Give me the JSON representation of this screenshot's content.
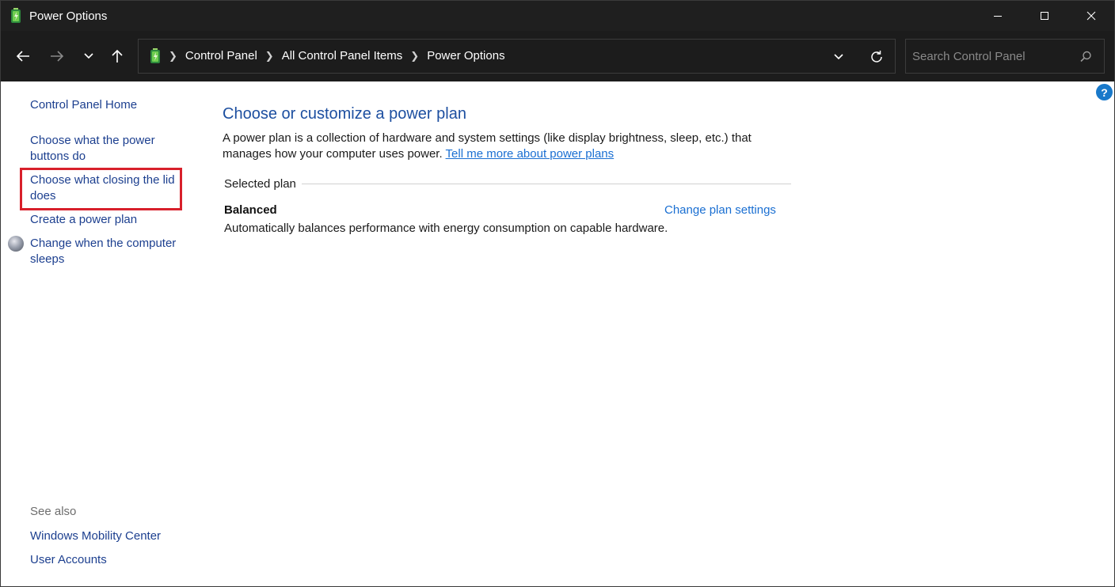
{
  "window": {
    "title": "Power Options"
  },
  "nav": {
    "breadcrumbs": [
      "Control Panel",
      "All Control Panel Items",
      "Power Options"
    ],
    "search_placeholder": "Search Control Panel"
  },
  "sidebar": {
    "home": "Control Panel Home",
    "links": [
      "Choose what the power buttons do",
      "Choose what closing the lid does",
      "Create a power plan",
      "Change when the computer sleeps"
    ],
    "see_also_label": "See also",
    "see_also_links": [
      "Windows Mobility Center",
      "User Accounts"
    ]
  },
  "main": {
    "heading": "Choose or customize a power plan",
    "description": "A power plan is a collection of hardware and system settings (like display brightness, sleep, etc.) that manages how your computer uses power.",
    "learn_more": "Tell me more about power plans",
    "selected_plan_label": "Selected plan",
    "plan": {
      "name": "Balanced",
      "change_link": "Change plan settings",
      "description": "Automatically balances performance with energy consumption on capable hardware."
    }
  },
  "help_icon_text": "?",
  "colors": {
    "link": "#1c3f8f",
    "accent_link": "#1a6fd2",
    "heading": "#1d4fa0",
    "highlight": "#d8202b",
    "titlebar": "#1f1f1f"
  }
}
